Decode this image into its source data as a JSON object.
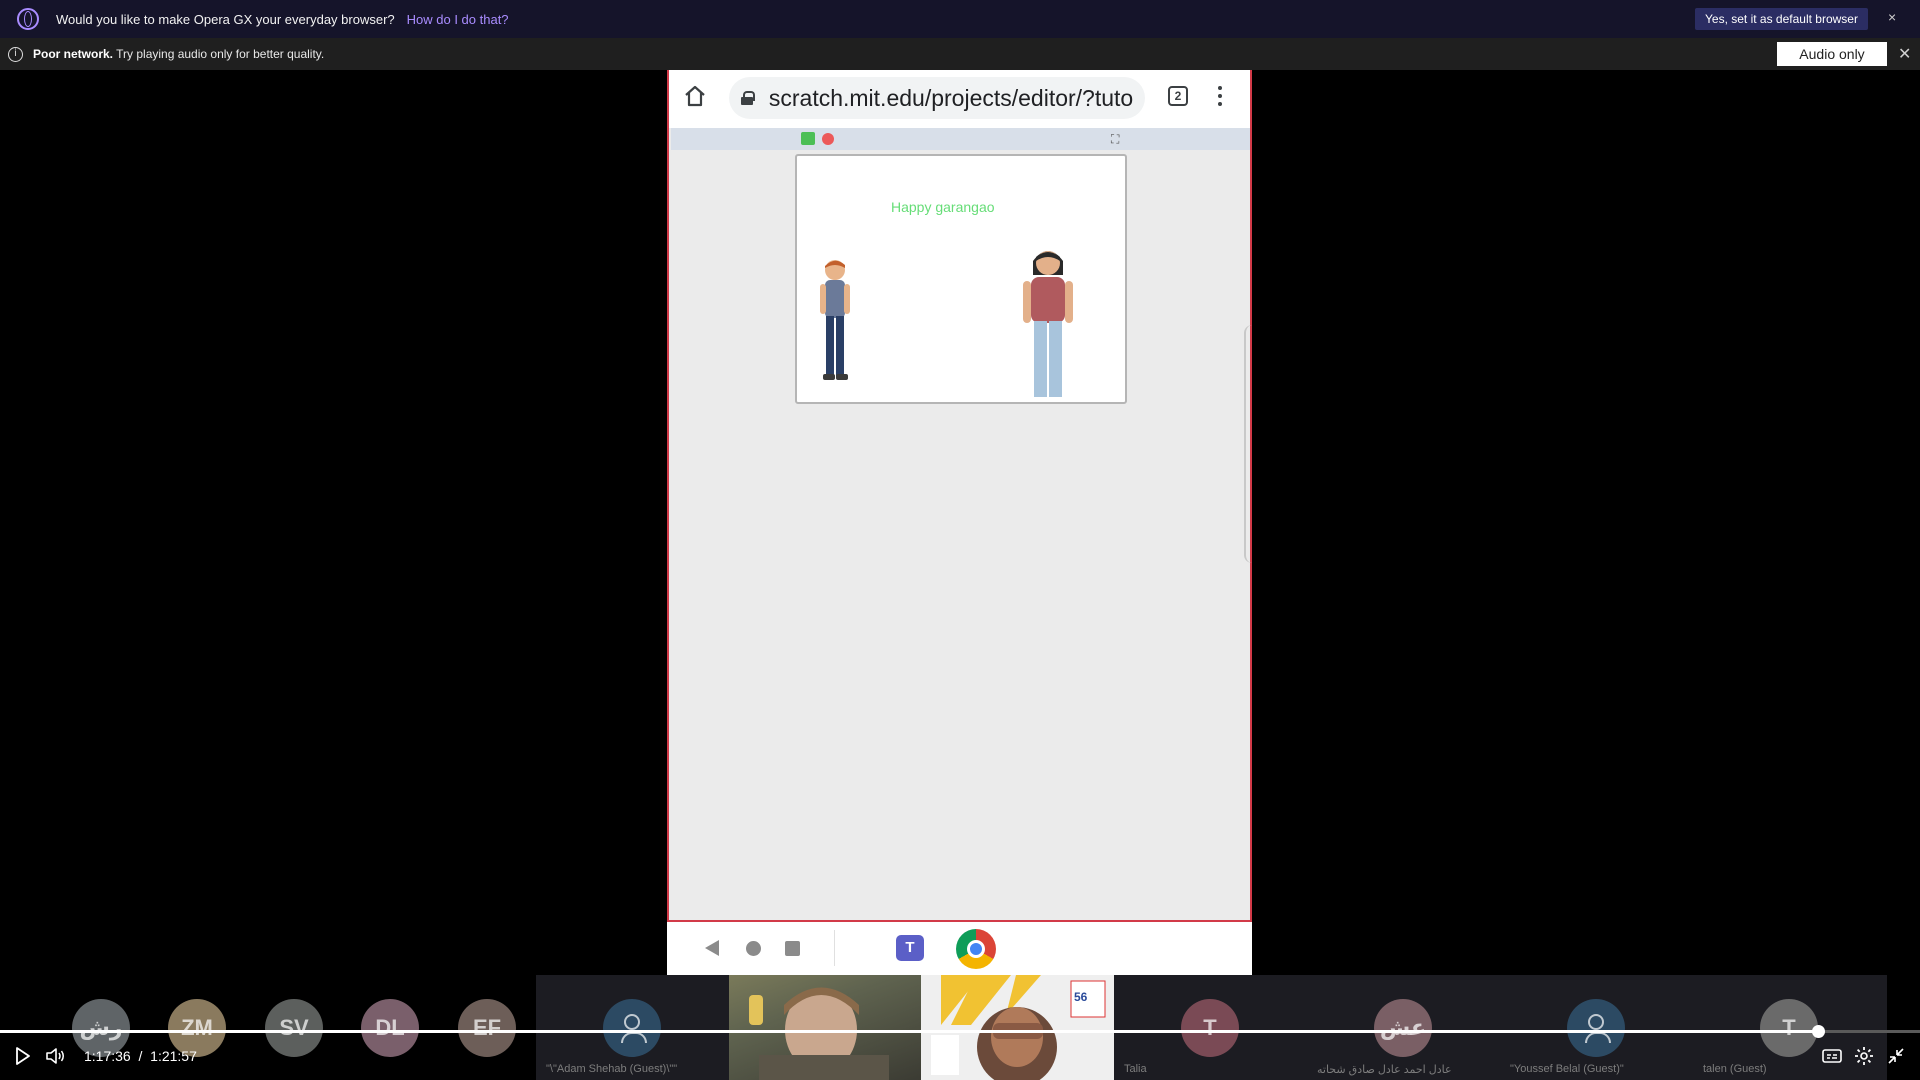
{
  "opera_bar": {
    "message": "Would you like to make Opera GX your everyday browser?",
    "link": "How do I do that?",
    "default_button": "Yes, set it as default browser",
    "close": "×"
  },
  "network_bar": {
    "bold": "Poor network.",
    "message": " Try playing audio only for better quality.",
    "audio_button": "Audio only",
    "close": "✕"
  },
  "phone": {
    "url": "scratch.mit.edu/projects/editor/?tuto",
    "tab_count": "2",
    "stage_text": "Happy garangao",
    "fullscreen": "⛶"
  },
  "participants": [
    {
      "initials": "رش",
      "color": "#5f6467"
    },
    {
      "initials": "ZM",
      "color": "#8a7a5e"
    },
    {
      "initials": "SV",
      "color": "#5c5f5d"
    },
    {
      "initials": "DL",
      "color": "#7a5f6b"
    },
    {
      "initials": "EF",
      "color": "#6d5e58"
    }
  ],
  "tiles": [
    {
      "name": "\"\\\"Adam Shehab (Guest)\\\"\"",
      "type": "icon",
      "color": "#2c4a63"
    },
    {
      "name": "",
      "type": "video-a"
    },
    {
      "name": "",
      "type": "video-b"
    },
    {
      "name": "Talia",
      "type": "avatar",
      "initials": "T",
      "color": "#7a4a55"
    },
    {
      "name": "عادل احمد عادل صادق شحاته",
      "type": "avatar",
      "initials": "عش",
      "color": "#7a5f65"
    },
    {
      "name": "\"Youssef Belal (Guest)\"",
      "type": "icon",
      "color": "#2c4a63"
    },
    {
      "name": "talen (Guest)",
      "type": "avatar",
      "initials": "T",
      "color": "#6a6a6a"
    }
  ],
  "player": {
    "current_time": "1:17:36",
    "separator": "/",
    "duration": "1:21:57",
    "progress_fraction": 0.947
  }
}
